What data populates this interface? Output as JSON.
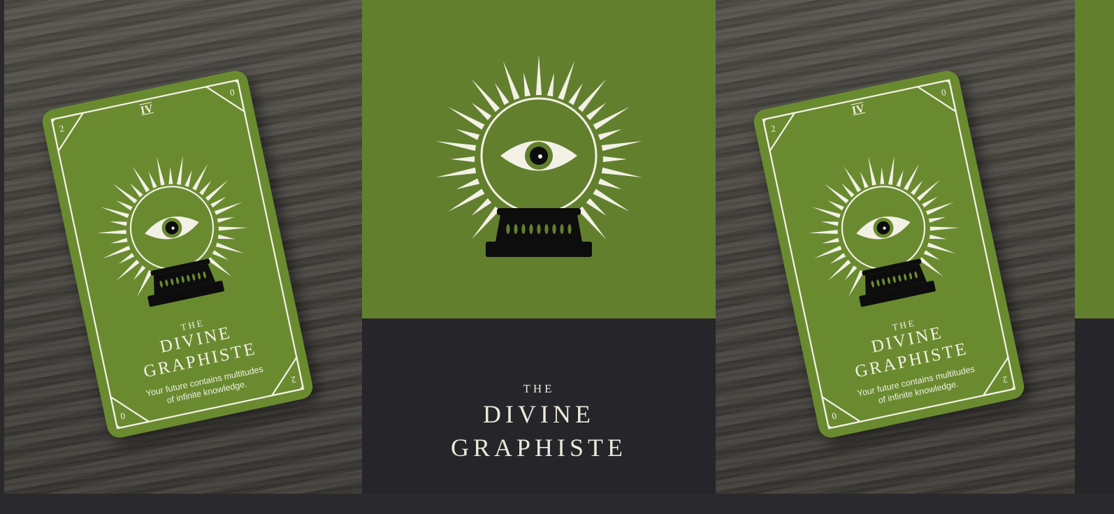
{
  "card": {
    "numeral": "IV",
    "corner_top_left": "2",
    "corner_top_right": "0",
    "corner_bottom_left": "0",
    "corner_bottom_right": "2",
    "title_the": "THE",
    "title_divine": "DIVINE",
    "title_graphiste": "GRAPHISTE",
    "tagline_1": "Your future contains multitudes",
    "tagline_2": "of infinite knowledge."
  },
  "poster": {
    "title_the": "THE",
    "title_divine": "DIVINE",
    "title_graphiste": "GRAPHISTE"
  },
  "colors": {
    "card_green": "#6a8a30",
    "poster_green": "#627f2e",
    "poster_dark": "#25252a",
    "ink": "#0d0d0d",
    "cream": "#f3f1e6"
  }
}
